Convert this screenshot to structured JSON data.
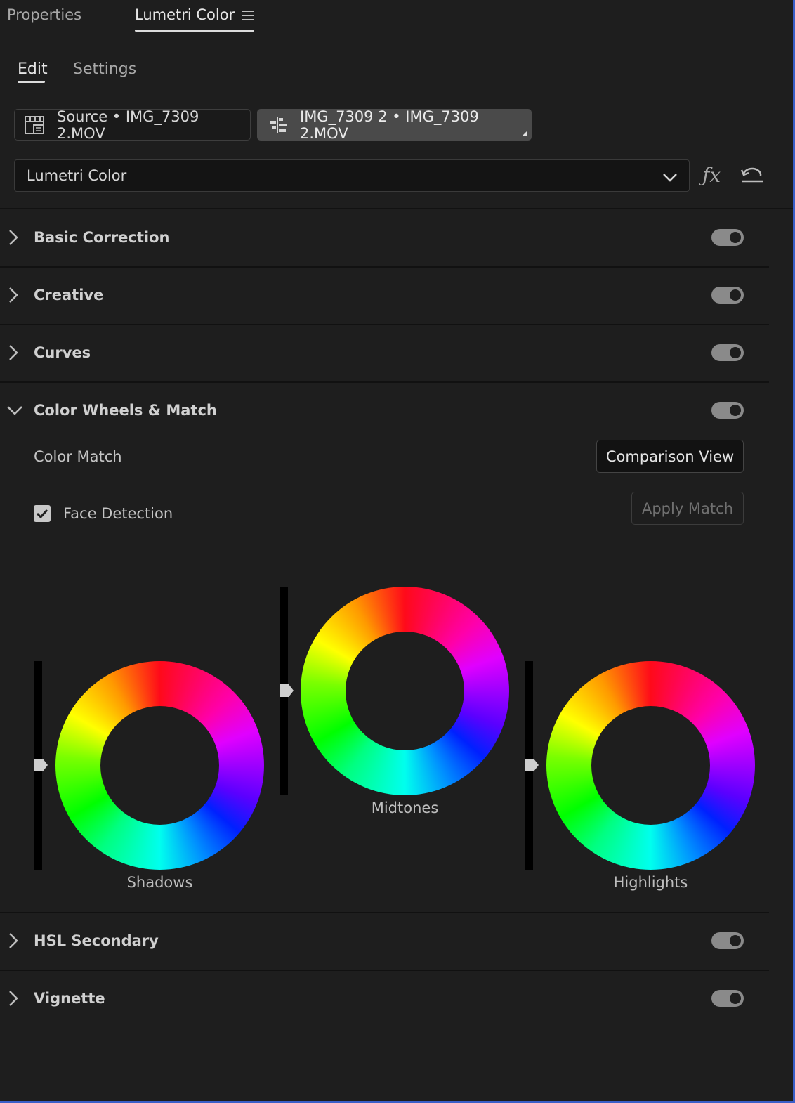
{
  "panel_tabs": [
    {
      "label": "Properties"
    },
    {
      "label": "Lumetri Color"
    }
  ],
  "sub_tabs": [
    {
      "label": "Edit"
    },
    {
      "label": "Settings"
    }
  ],
  "clips": {
    "source": "Source • IMG_7309 2.MOV",
    "sequence": "IMG_7309 2 • IMG_7309 2.MOV"
  },
  "effect_dropdown": {
    "value": "Lumetri Color"
  },
  "sections": [
    {
      "title": "Basic Correction",
      "enabled": true,
      "expanded": false
    },
    {
      "title": "Creative",
      "enabled": true,
      "expanded": false
    },
    {
      "title": "Curves",
      "enabled": true,
      "expanded": false
    },
    {
      "title": "Color Wheels & Match",
      "enabled": true,
      "expanded": true
    },
    {
      "title": "HSL Secondary",
      "enabled": true,
      "expanded": false
    },
    {
      "title": "Vignette",
      "enabled": true,
      "expanded": false
    }
  ],
  "color_match": {
    "label": "Color Match",
    "comparison_button": "Comparison View",
    "apply_button": "Apply Match",
    "face_detection": {
      "label": "Face Detection",
      "checked": true
    }
  },
  "wheels": [
    {
      "label": "Shadows"
    },
    {
      "label": "Midtones"
    },
    {
      "label": "Highlights"
    }
  ],
  "colors": {
    "background": "#1e1e1e",
    "toggle_on": "#8a8a8a",
    "selection_border": "#3a5fc8"
  }
}
